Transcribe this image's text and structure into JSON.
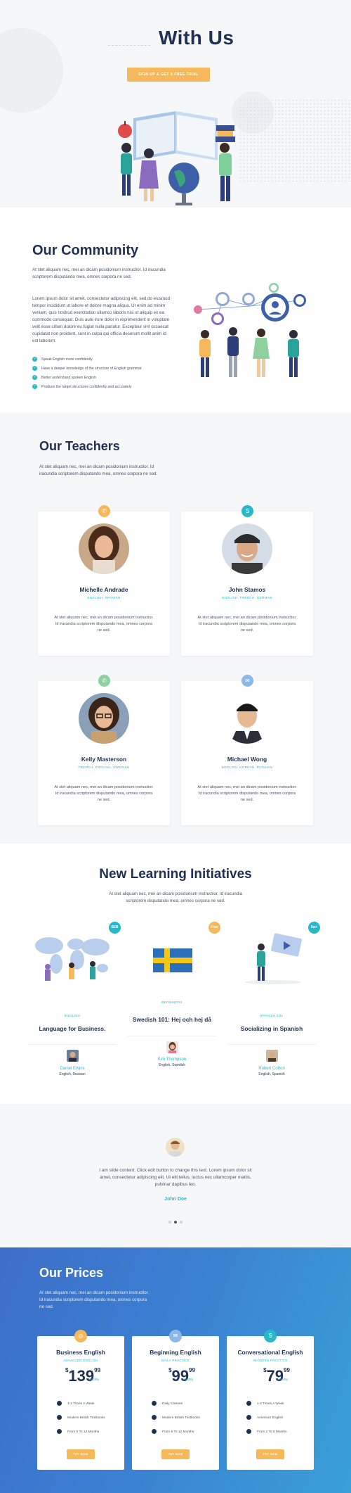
{
  "hero": {
    "title": "With Us",
    "cta_label": "SIGN UP & GET A FREE TRIAL"
  },
  "community": {
    "title": "Our Community",
    "intro": "At stet aliquam nec, mei an dicam posidonium instructior. Id iracundia scriptorem disputando mea, omnes corpora ne sed.",
    "body": "Lorem ipsum dolor sit amet, consectetur adipiscing elit, sed do eiusmod tempor incididunt ut labore et dolore magna aliqua. Ut enim ad minim veniam, quis nostrud exercitation ullamco laboris nisi ut aliquip ex ea commodo consequat. Duis aute irure dolor in reprehenderit in voluptate velit esse cillum dolore eu fugiat nulla pariatur. Excepteur sint occaecat cupidatat non proident, sunt in culpa qui officia deserunt mollit anim id est laborum.",
    "checklist": [
      "Speak English more confidently",
      "Have a deeper knowledge of the structure of English grammar",
      "Better understand spoken English",
      "Produce the target structures confidently and accurately"
    ]
  },
  "teachers": {
    "title": "Our Teachers",
    "intro": "At stet aliquam nec, mei an dicam posidonium instructior. Id iracundia scriptorem disputando mea, omnes corpora ne sed.",
    "cards": [
      {
        "name": "Michelle Andrade",
        "langs": "ENGLISH, SPANISH",
        "bio": "At stet aliquam nec, mei an dicam posidonium instructior. Id iracundia scriptorem disputando mea, omnes corpora ne sed.",
        "icon_color": "#f5b85a",
        "icon": "whatsapp-icon"
      },
      {
        "name": "John Stamos",
        "langs": "ENGLISH, FRENCH, GERMAN",
        "bio": "At stet aliquam nec, mei an dicam posidonium instructior. Id iracundia scriptorem disputando mea, omnes corpora ne sed.",
        "icon_color": "#27b8c9",
        "icon": "skype-icon"
      },
      {
        "name": "Kelly Masterson",
        "langs": "FRENCH, ENGLISH, SWEDISH",
        "bio": "At stet aliquam nec, mei an dicam posidonium instructior. Id iracundia scriptorem disputando mea, omnes corpora ne sed.",
        "icon_color": "#8fd0a0",
        "icon": "whatsapp-icon"
      },
      {
        "name": "Michael Wong",
        "langs": "ENGLISH, KOREAN, RUSSIAN",
        "bio": "At stet aliquam nec, mei an dicam posidonium instructior. Id iracundia scriptorem disputando mea, omnes corpora ne sed.",
        "icon_color": "#8bb8e8",
        "icon": "chat-icon"
      }
    ]
  },
  "initiatives": {
    "title": "New Learning Initiatives",
    "intro": "At stet aliquam nec, mei an dicam posidonium instructior. Id iracundia scriptorem disputando mea, omnes corpora ne sed.",
    "cards": [
      {
        "badge": "B2B",
        "badge_color": "#27b8c9",
        "category": "ENGLISH",
        "title": "Language for Business.",
        "author": "Daniel Evans",
        "langs": "English, Russian"
      },
      {
        "badge": "Free",
        "badge_color": "#f5b85a",
        "category": "BEGINNERS",
        "title": "Swedish 101: Hej och hej då",
        "author": "Kim Thompson",
        "langs": "English, Swedish"
      },
      {
        "badge": "5w+",
        "badge_color": "#27b8c9",
        "category": "SPANISH ESL",
        "title": "Socializing in Spanish",
        "author": "Robert Cotton",
        "langs": "English, Spanish"
      }
    ]
  },
  "testimonial": {
    "quote": "I am slide content. Click edit button to change this text. Lorem ipsum dolor sit amet, consectetur adipiscing elit. Ut elit tellus, luctus nec ullamcorper mattis, pulvinar dapibus leo.",
    "author": "John Doe"
  },
  "prices": {
    "title": "Our Prices",
    "intro": "At stet aliquam nec, mei an dicam posidonium instructior. Id iracundia scriptorem disputando mea, omnes corpora ne sed.",
    "cards": [
      {
        "title": "Business English",
        "subtitle": "ADVANCED ENGLISH",
        "currency": "$",
        "amount": "139",
        "cents": "99",
        "period": "Monthly",
        "features": [
          "1-2 Times A Week",
          "Modern British Textbooks",
          "From 6 To 12 Months"
        ],
        "button": "TRY NOW",
        "icon_color": "#f5b85a",
        "icon": "globe-icon"
      },
      {
        "title": "Beginning English",
        "subtitle": "DAILY PRACTICE",
        "currency": "$",
        "amount": "99",
        "cents": "99",
        "period": "Monthly",
        "features": [
          "Daily Classes",
          "Modern British Textbooks",
          "From 6 To 12 Months"
        ],
        "button": "TRY NOW",
        "icon_color": "#8bb8e8",
        "icon": "chat-icon"
      },
      {
        "title": "Conversational English",
        "subtitle": "IN-DEPTH PRACTICE",
        "currency": "$",
        "amount": "79",
        "cents": "99",
        "period": "Monthly",
        "features": [
          "1-2 Times A Week",
          "American English",
          "From 2 To 6 Months"
        ],
        "button": "TRY NOW",
        "icon_color": "#27b8c9",
        "icon": "skype-icon"
      }
    ]
  }
}
